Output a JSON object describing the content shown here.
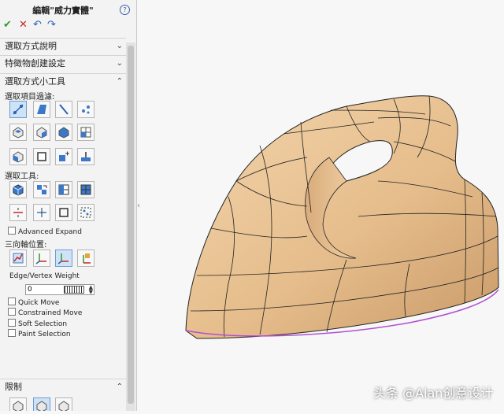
{
  "panel": {
    "title": "編輯\"威力實體\"",
    "help_icon": "help-circle-icon",
    "ok_icon": "check-icon",
    "cancel_icon": "close-icon",
    "undo_icon": "undo-icon",
    "redo_icon": "redo-icon"
  },
  "sections": {
    "selection_help": "選取方式說明",
    "feature_create": "特徵物創建設定",
    "selection_tools": "選取方式小工具",
    "limit": "限制"
  },
  "labels": {
    "filter": "選取項目過濾:",
    "tools": "選取工具:",
    "triad": "三向軸位置:",
    "edge_vertex_weight": "Edge/Vertex Weight"
  },
  "checkboxes": {
    "advanced_expand": "Advanced Expand",
    "quick_move": "Quick Move",
    "constrained_move": "Constrained Move",
    "soft_selection": "Soft Selection",
    "paint_selection": "Paint Selection"
  },
  "weight_value": "0",
  "watermark": "头条 @Alan创意设计",
  "colors": {
    "model": "#e8c49a",
    "edge": "#222222",
    "accent": "#cfe3f7"
  }
}
